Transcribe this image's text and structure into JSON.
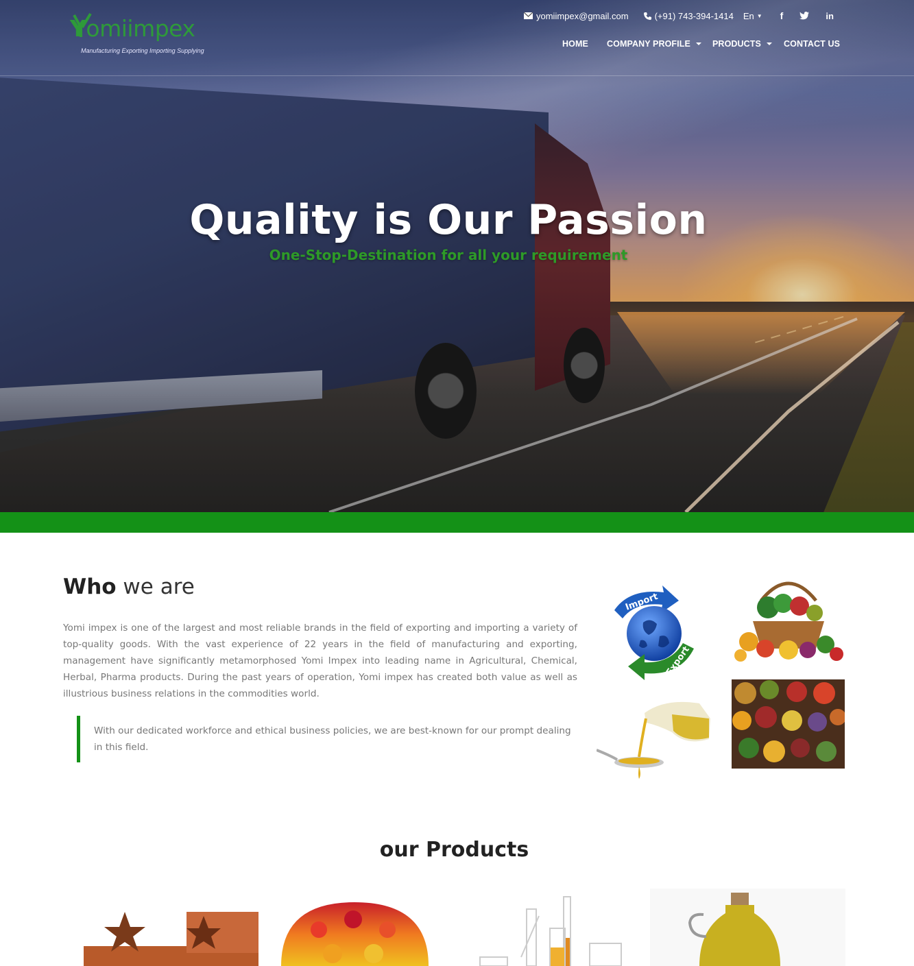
{
  "brand": {
    "logo_text_y": "Y",
    "logo_text_rest": "omiimpex",
    "tagline": "Manufacturing Exporting Importing Supplying",
    "colors": {
      "primary_green": "#149117",
      "logo_green": "#2e9a3a"
    }
  },
  "topbar": {
    "email": "yomiimpex@gmail.com",
    "phone": "(+91) 743-394-1414",
    "language": "En",
    "social": [
      {
        "name": "facebook-icon",
        "glyph": "f"
      },
      {
        "name": "twitter-icon",
        "glyph": "🐦"
      },
      {
        "name": "linkedin-icon",
        "glyph": "in"
      }
    ]
  },
  "nav": {
    "home": "HOME",
    "company_profile": "COMPANY PROFILE",
    "products": "PRODUCTS",
    "contact": "CONTACT US"
  },
  "hero": {
    "title": "Quality is Our Passion",
    "subtitle": "One-Stop-Destination for all your requirement"
  },
  "who": {
    "title_bold": "Who",
    "title_light": " we are",
    "paragraph": "Yomi impex is one of the largest and most reliable brands in the field of exporting and importing a variety of top-quality goods. With the vast experience of 22 years in the field of manufacturing and exporting, management have significantly metamorphosed Yomi Impex into leading name in Agricultural, Chemical, Herbal, Pharma products. During the past years of operation, Yomi impex has created both value as well as illustrious business relations in the commodities world.",
    "quote": "With our dedicated workforce and ethical business policies, we are best-known for our prompt dealing in this field.",
    "globe_labels": {
      "import": "Import",
      "export": "Export"
    }
  },
  "products": {
    "title_light": "our ",
    "title_bold": "Products"
  }
}
